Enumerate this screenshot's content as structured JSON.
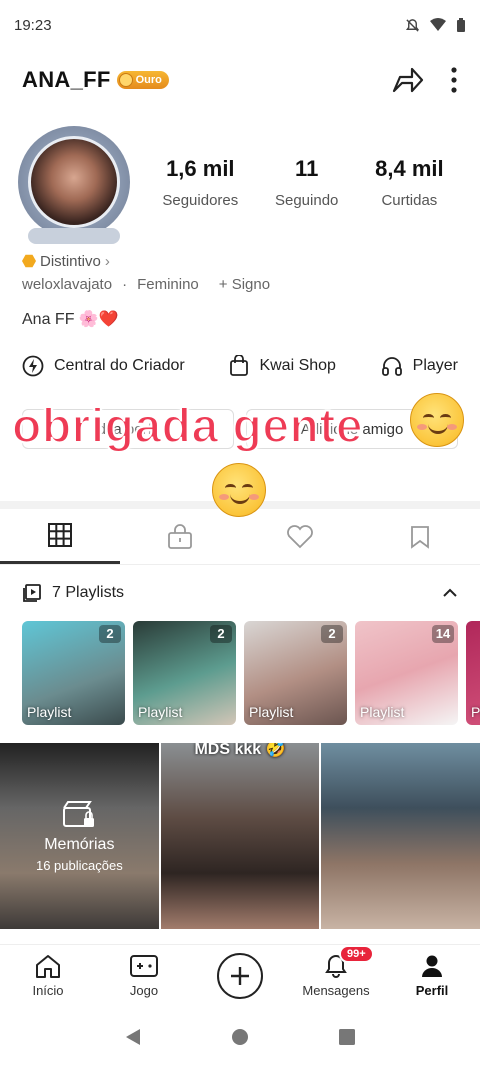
{
  "status_bar": {
    "time": "19:23"
  },
  "header": {
    "username": "ANA_FF",
    "badge_label": "Ouro"
  },
  "stats": [
    {
      "value": "1,6 mil",
      "label": "Seguidores"
    },
    {
      "value": "11",
      "label": "Seguindo"
    },
    {
      "value": "8,4 mil",
      "label": "Curtidas"
    }
  ],
  "profile": {
    "distintivo": "Distintivo",
    "handle": "weloxlavajato",
    "gender": "Feminino",
    "signo": "+ Signo",
    "bio": "Ana FF 🌸❤️"
  },
  "quick_links": [
    {
      "label": "Central do Criador",
      "icon": "lightning-icon"
    },
    {
      "label": "Kwai Shop",
      "icon": "shopping-bag-icon"
    },
    {
      "label": "Player",
      "icon": "headphones-icon"
    }
  ],
  "overlay": {
    "caption": "obrigada gente"
  },
  "hidden_buttons": [
    "dita perfil",
    "Adicione amigo"
  ],
  "tabs": [
    "grid-icon",
    "lock-icon",
    "heart-icon",
    "bookmark-icon"
  ],
  "playlists": {
    "header": "7 Playlists",
    "items": [
      {
        "label": "Playlist",
        "count": "2",
        "bg": "#6fb7c7"
      },
      {
        "label": "Playlist",
        "count": "2",
        "bg": "#3f5f5a"
      },
      {
        "label": "Playlist",
        "count": "2",
        "bg": "#c9c1c5"
      },
      {
        "label": "Playlist",
        "count": "14",
        "bg": "#e4b3bb"
      },
      {
        "label": "Pla",
        "count": "",
        "bg": "#c23e68"
      }
    ]
  },
  "grid": {
    "memorias_title": "Memórias",
    "memorias_sub": "16 publicações",
    "second_caption": "MDS kkk 🤣"
  },
  "bottom_nav": [
    {
      "label": "Início",
      "icon": "home-icon"
    },
    {
      "label": "Jogo",
      "icon": "gamepad-icon"
    },
    {
      "label": "",
      "icon": "add-icon"
    },
    {
      "label": "Mensagens",
      "icon": "bell-icon",
      "badge": "99+"
    },
    {
      "label": "Perfil",
      "icon": "person-icon"
    }
  ],
  "colors": {
    "caption": "#ee3b55",
    "badge": "#f2a91e",
    "notif": "#e8243b"
  }
}
